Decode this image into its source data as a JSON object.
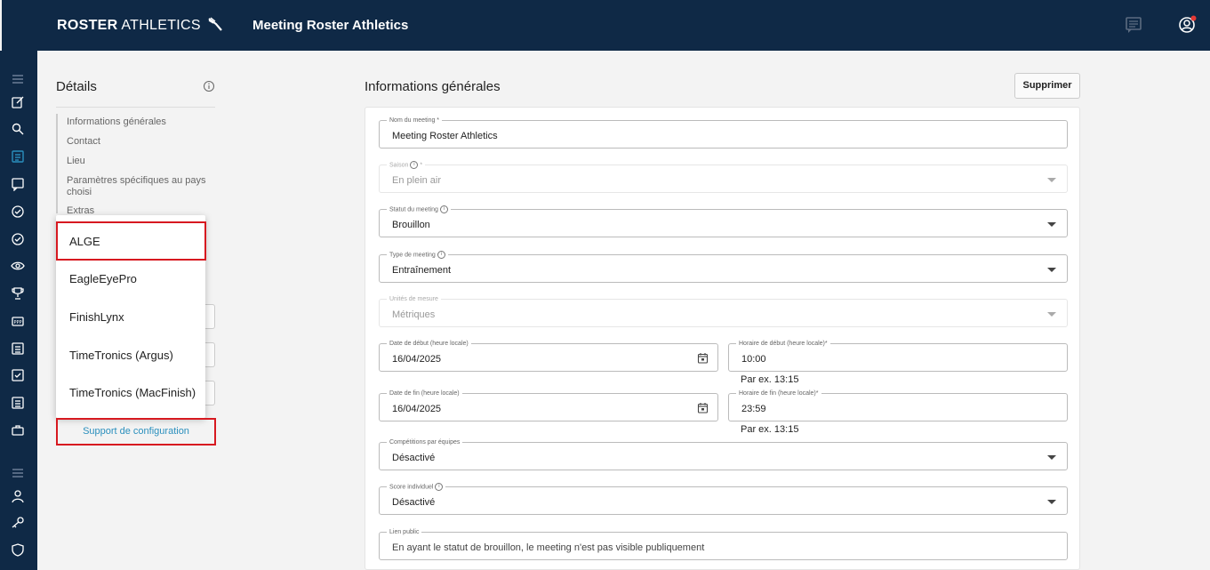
{
  "header": {
    "logo_bold": "ROSTER",
    "logo_light": " ATHLETICS",
    "title": "Meeting Roster Athletics",
    "chat_icon": "chat-icon",
    "account_icon": "account-circle-icon",
    "notification_color": "#e53935"
  },
  "sidebar": {
    "icons": [
      "menu-icon",
      "edit-icon",
      "search-icon",
      "list-icon",
      "comment-icon",
      "check-circle-icon",
      "check-circle-icon",
      "eye-icon",
      "trophy-icon",
      "badge-icon",
      "document-icon",
      "task-icon",
      "document-icon",
      "briefcase-icon",
      "menu-icon",
      "person-icon",
      "key-icon",
      "shield-icon"
    ],
    "active_color": "#2a8fbd"
  },
  "details": {
    "title": "Détails",
    "nav": [
      "Informations générales",
      "Contact",
      "Lieu",
      "Paramètres spécifiques au pays choisi",
      "Extras"
    ],
    "support_label": "Support de configuration"
  },
  "menu": {
    "items": [
      "ALGE",
      "EagleEyePro",
      "FinishLynx",
      "TimeTronics (Argus)",
      "TimeTronics (MacFinish)"
    ]
  },
  "form": {
    "section_title": "Informations générales",
    "delete_label": "Supprimer",
    "meeting_name": {
      "label": "Nom du meeting *",
      "value": "Meeting Roster Athletics"
    },
    "season": {
      "label": "Saison",
      "label_suffix": " *",
      "value": "En plein air"
    },
    "status": {
      "label": "Statut du meeting",
      "value": "Brouillon"
    },
    "type": {
      "label": "Type de meeting",
      "value": "Entraînement"
    },
    "units": {
      "label": "Unités de mesure",
      "value": "Métriques"
    },
    "start_date": {
      "label": "Date de début (heure locale)",
      "value": "16/04/2025"
    },
    "start_time": {
      "label": "Horaire de début (heure locale)*",
      "value": "10:00",
      "hint": "Par ex. 13:15"
    },
    "end_date": {
      "label": "Date de fin (heure locale)",
      "value": "16/04/2025"
    },
    "end_time": {
      "label": "Horaire de fin (heure locale)*",
      "value": "23:59",
      "hint": "Par ex. 13:15"
    },
    "team_comp": {
      "label": "Compétitions par équipes",
      "value": "Désactivé"
    },
    "individual_score": {
      "label": "Score individuel",
      "value": "Désactivé"
    },
    "public_link": {
      "label": "Lien public",
      "value": "En ayant le statut de brouillon, le meeting n'est pas visible publiquement"
    }
  }
}
